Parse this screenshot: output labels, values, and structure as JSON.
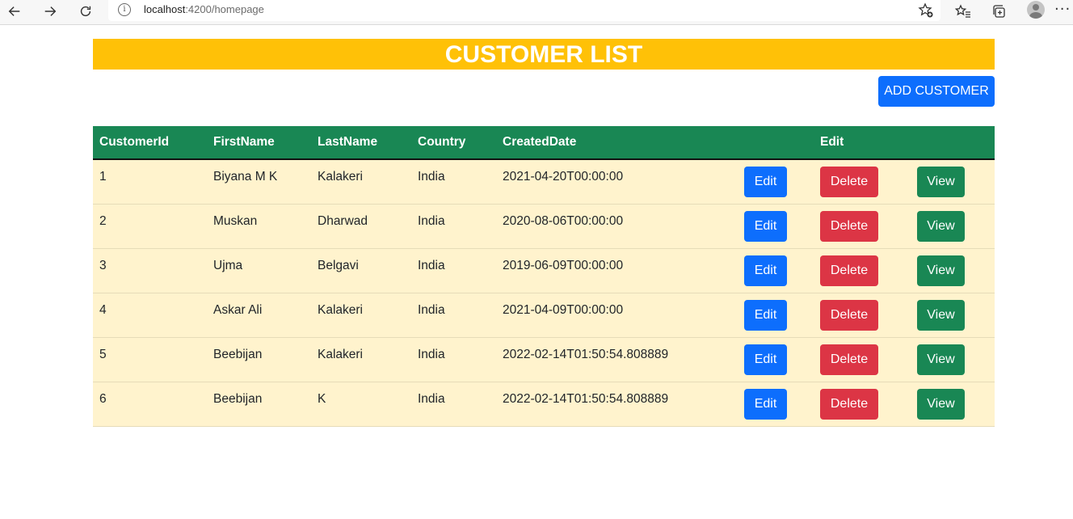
{
  "browser": {
    "url_host": "localhost",
    "url_path": ":4200/homepage"
  },
  "page": {
    "title": "CUSTOMER LIST",
    "add_button": "ADD CUSTOMER"
  },
  "table": {
    "headers": [
      "CustomerId",
      "FirstName",
      "LastName",
      "Country",
      "CreatedDate",
      "",
      "Edit",
      ""
    ],
    "actions": {
      "edit": "Edit",
      "delete": "Delete",
      "view": "View"
    },
    "rows": [
      {
        "id": "1",
        "first": "Biyana M K",
        "last": "Kalakeri",
        "country": "India",
        "created": "2021-04-20T00:00:00"
      },
      {
        "id": "2",
        "first": "Muskan",
        "last": "Dharwad",
        "country": "India",
        "created": "2020-08-06T00:00:00"
      },
      {
        "id": "3",
        "first": "Ujma",
        "last": "Belgavi",
        "country": "India",
        "created": "2019-06-09T00:00:00"
      },
      {
        "id": "4",
        "first": "Askar Ali",
        "last": "Kalakeri",
        "country": "India",
        "created": "2021-04-09T00:00:00"
      },
      {
        "id": "5",
        "first": "Beebijan",
        "last": "Kalakeri",
        "country": "India",
        "created": "2022-02-14T01:50:54.808889"
      },
      {
        "id": "6",
        "first": "Beebijan",
        "last": "K",
        "country": "India",
        "created": "2022-02-14T01:50:54.808889"
      }
    ]
  },
  "colors": {
    "banner": "#ffc107",
    "header": "#198754",
    "row": "#fff3cd",
    "primary": "#0d6efd",
    "danger": "#dc3545",
    "success": "#198754"
  },
  "icons": {
    "back": "arrow-left-icon",
    "forward": "arrow-right-icon",
    "reload": "reload-icon",
    "info": "info-icon",
    "favorite": "star-add-icon",
    "favorites": "favorites-icon",
    "collections": "collections-icon",
    "profile": "avatar",
    "menu": "more-icon"
  }
}
